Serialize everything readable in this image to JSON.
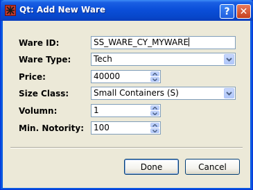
{
  "window": {
    "title": "Qt: Add New Ware"
  },
  "titlebar": {
    "help_label": "?",
    "close_label": "✕"
  },
  "form": {
    "ware_id": {
      "label": "Ware ID:",
      "value": "SS_WARE_CY_MYWARE"
    },
    "ware_type": {
      "label": "Ware Type:",
      "value": "Tech"
    },
    "price": {
      "label": "Price:",
      "value": "40000"
    },
    "size_class": {
      "label": "Size Class:",
      "value": "Small Containers (S)"
    },
    "volumn": {
      "label": "Volumn:",
      "value": "1"
    },
    "min_notority": {
      "label": "Min. Notority:",
      "value": "100"
    }
  },
  "buttons": {
    "done_label": "Done",
    "cancel_label": "Cancel"
  },
  "icons": {
    "app": "qt-app-icon",
    "combo_arrow": "chevron-down-icon",
    "spin_up": "arrow-up-icon",
    "spin_down": "arrow-down-icon"
  },
  "colors": {
    "titlebar": "#0b4fd9",
    "client_bg": "#ece9d8",
    "field_border": "#7f9db9",
    "button_border": "#003c74"
  }
}
